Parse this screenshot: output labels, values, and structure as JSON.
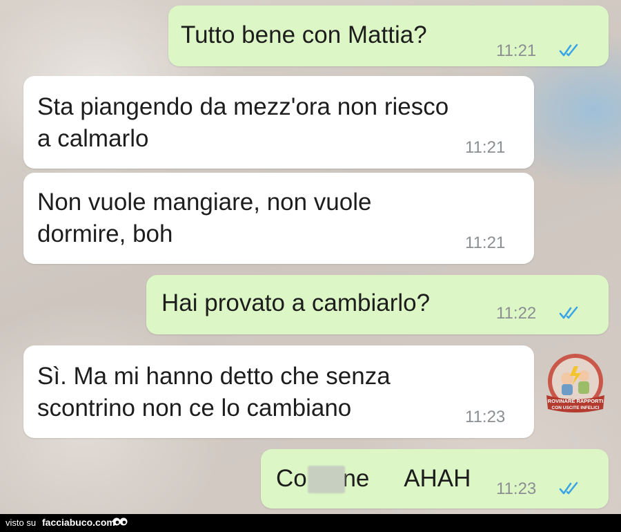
{
  "messages": [
    {
      "direction": "sent",
      "text": "Tutto bene con Mattia?",
      "time": "11:21",
      "status": "read"
    },
    {
      "direction": "received",
      "text": "Sta piangendo da mezz'ora non riesco\na calmarlo",
      "time": "11:21"
    },
    {
      "direction": "received",
      "text": "Non vuole mangiare, non vuole\ndormire, boh",
      "time": "11:21"
    },
    {
      "direction": "sent",
      "text": "Hai provato a cambiarlo?",
      "time": "11:22",
      "status": "read"
    },
    {
      "direction": "received",
      "text": "Sì. Ma mi hanno detto che senza\nscontrino non ce lo cambiano",
      "time": "11:23"
    },
    {
      "direction": "sent",
      "text": "Co ne AHAH",
      "time": "11:23",
      "status": "read",
      "censored": true
    }
  ],
  "watermark": {
    "line1": "ROVINARE RAPPORTI",
    "line2": "CON USCITE INFELICI"
  },
  "footer": {
    "prefix": "visto su",
    "site": "facciabuco.com"
  },
  "colors": {
    "sent_bubble": "#dcf7c5",
    "received_bubble": "#ffffff",
    "read_ticks": "#3aa4e8",
    "time_text": "#8b8f92"
  },
  "icons": [
    "double-check-icon",
    "eyes-icon"
  ]
}
